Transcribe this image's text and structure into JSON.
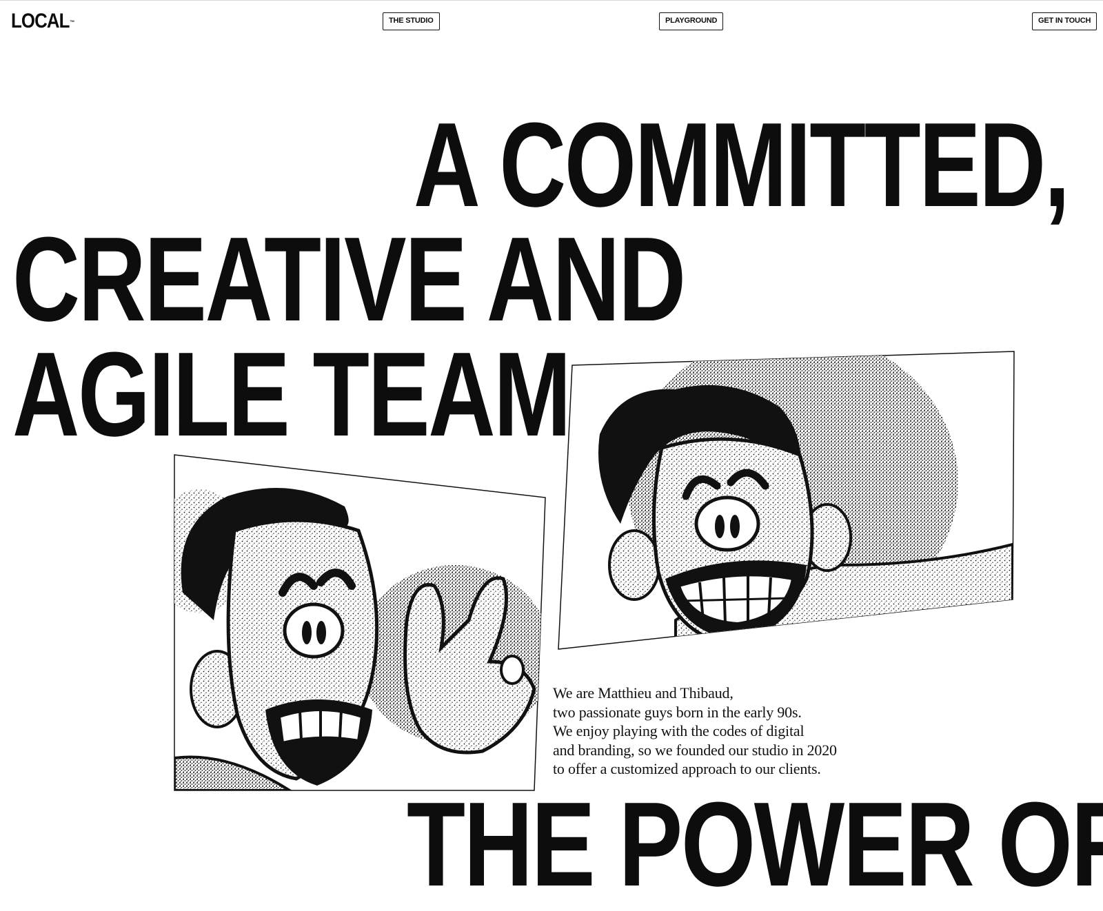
{
  "nav": {
    "logo": "LOCAL",
    "logo_mark": "™",
    "links": [
      "THE STUDIO",
      "PLAYGROUND",
      "GET IN TOUCH"
    ]
  },
  "hero": {
    "headline_lines": [
      "A COMMITTED,",
      "CREATIVE AND",
      "AGILE TEAM"
    ],
    "next_section_heading": "THE POWER OF"
  },
  "intro": {
    "lines": [
      "We are Matthieu and Thibaud,",
      "two passionate guys born in the early 90s.",
      "We enjoy playing with the codes of digital",
      "and branding, so we founded our studio in 2020",
      "to offer a customized approach to our clients."
    ]
  },
  "illustrations": [
    "illustration-matthieu",
    "illustration-thibaud"
  ],
  "colors": {
    "ink": "#0d0d0d",
    "paper": "#ffffff"
  }
}
